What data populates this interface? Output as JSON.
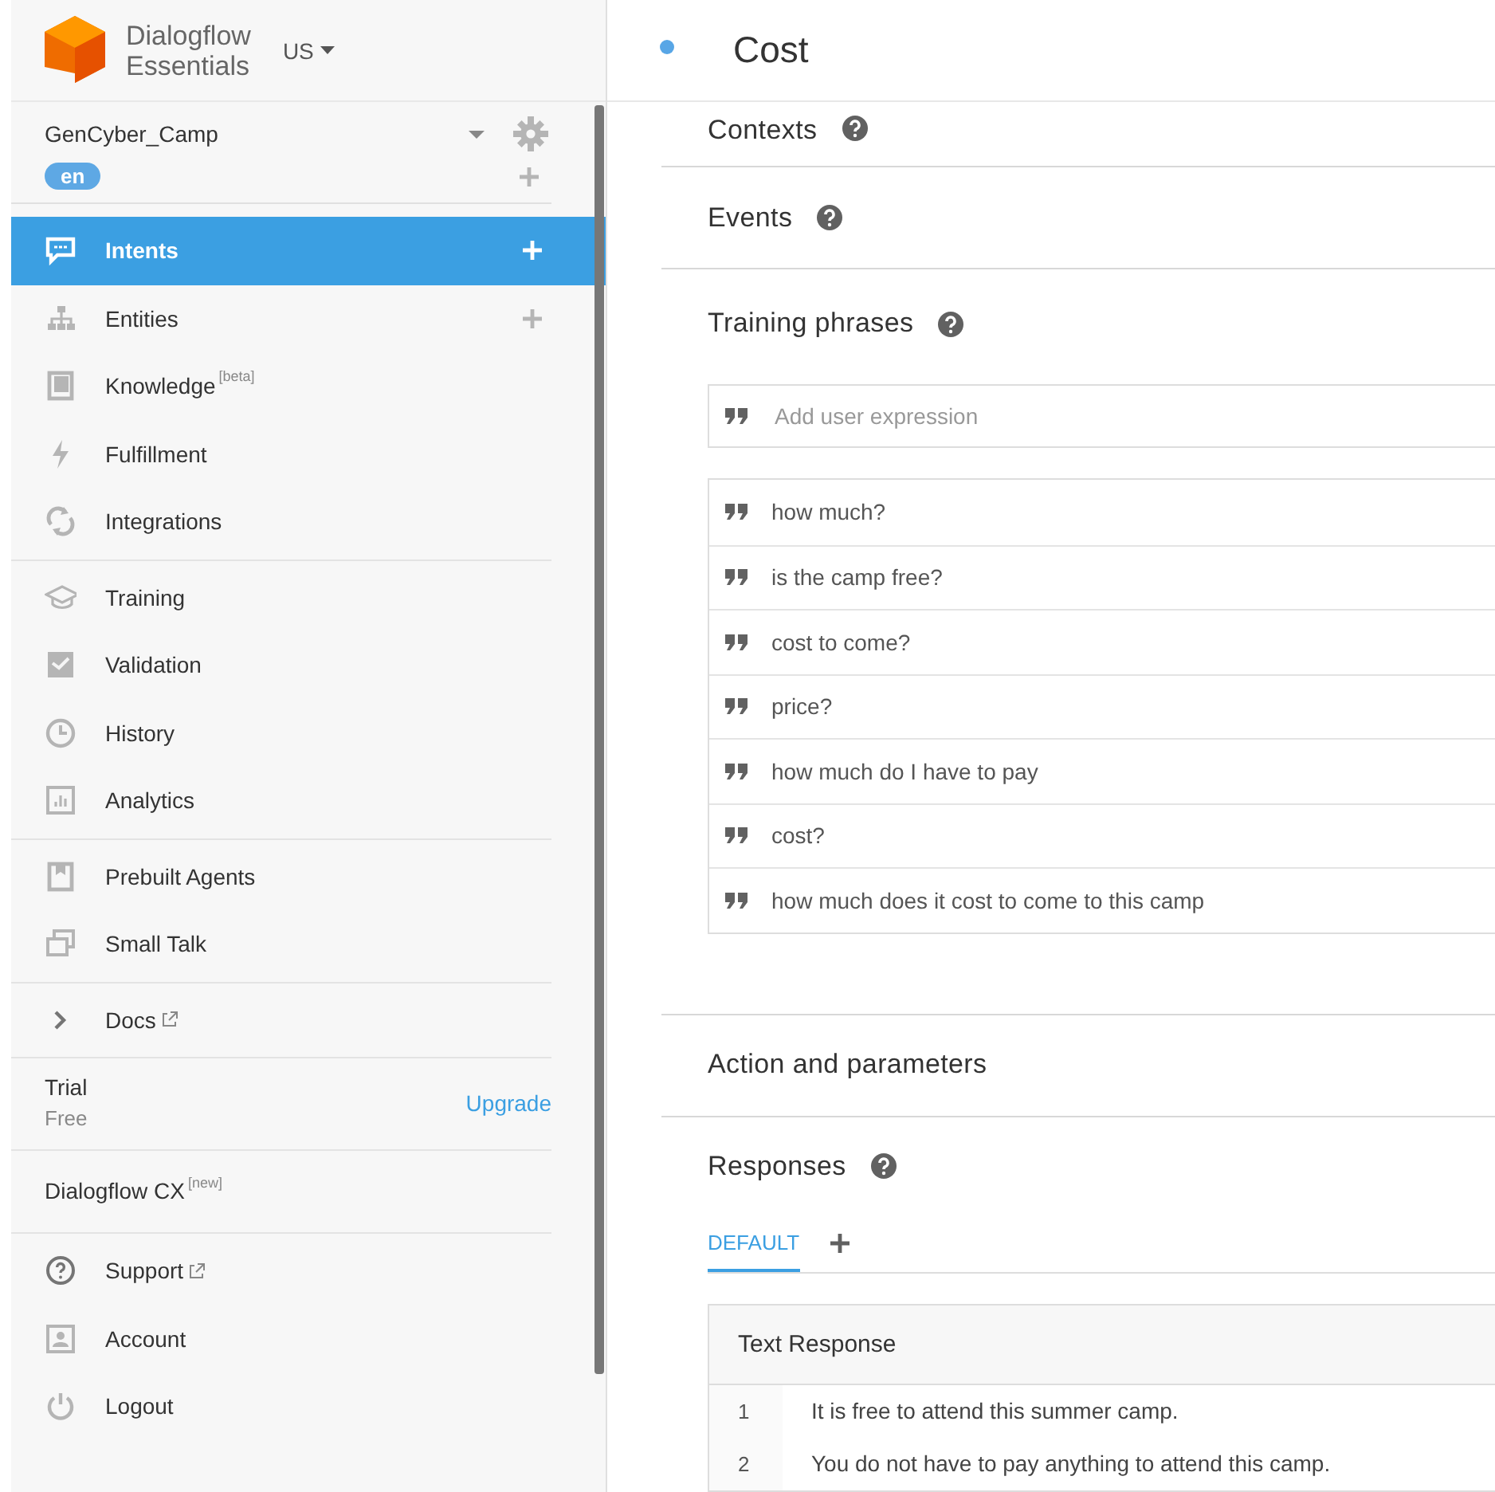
{
  "brand": {
    "line_1": "Dialogflow",
    "line_2": "Essentials",
    "region": "US"
  },
  "agent": {
    "name": "GenCyber_Camp",
    "language": "en"
  },
  "sidebar": {
    "groups": [
      [
        {
          "kind": "nav",
          "label": "Intents",
          "selected": true,
          "add": true
        },
        {
          "kind": "nav",
          "label": "Entities",
          "selected": false,
          "add": true
        },
        {
          "kind": "nav",
          "label": "Knowledge",
          "badge": "[beta]",
          "selected": false
        },
        {
          "kind": "nav",
          "label": "Fulfillment",
          "selected": false
        },
        {
          "kind": "nav",
          "label": "Integrations",
          "selected": false
        }
      ],
      [
        {
          "kind": "nav",
          "label": "Training",
          "selected": false
        },
        {
          "kind": "nav",
          "label": "Validation",
          "selected": false
        },
        {
          "kind": "nav",
          "label": "History",
          "selected": false
        },
        {
          "kind": "nav",
          "label": "Analytics",
          "selected": false
        }
      ],
      [
        {
          "kind": "nav",
          "label": "Prebuilt Agents",
          "selected": false
        },
        {
          "kind": "nav",
          "label": "Small Talk",
          "selected": false
        }
      ],
      [
        {
          "kind": "expander",
          "label": "Docs",
          "external": true,
          "selected": false
        }
      ],
      [
        {
          "kind": "plan",
          "label": "Trial",
          "sublabel": "Free",
          "action": "Upgrade"
        }
      ],
      [
        {
          "kind": "plain",
          "label": "Dialogflow CX",
          "badge": "[new]"
        }
      ],
      [
        {
          "kind": "nav",
          "label": "Support",
          "external": true,
          "selected": false
        },
        {
          "kind": "nav",
          "label": "Account",
          "selected": false
        },
        {
          "kind": "nav",
          "label": "Logout",
          "selected": false
        }
      ]
    ]
  },
  "intent": {
    "title": "Cost",
    "sections": [
      {
        "kind": "collapsed",
        "title": "Contexts",
        "help": true
      },
      {
        "kind": "collapsed",
        "title": "Events",
        "help": true
      },
      {
        "kind": "phrases",
        "title": "Training phrases",
        "help": true,
        "placeholder": "Add user expression",
        "phrases": [
          "how much?",
          "is the camp free?",
          "cost to come?",
          "price?",
          "how much do I have to pay",
          "cost?",
          "how much does it cost to come to this camp"
        ]
      },
      {
        "kind": "collapsed",
        "title": "Action and parameters",
        "help": false
      },
      {
        "kind": "responses",
        "title": "Responses",
        "help": true,
        "tabs": [
          {
            "label": "DEFAULT",
            "selected": true
          }
        ],
        "table": {
          "title": "Text Response",
          "rows": [
            {
              "index": "1",
              "text": "It is free to attend this summer camp."
            },
            {
              "index": "2",
              "text": "You do not have to pay anything to attend this camp."
            }
          ]
        }
      }
    ]
  }
}
